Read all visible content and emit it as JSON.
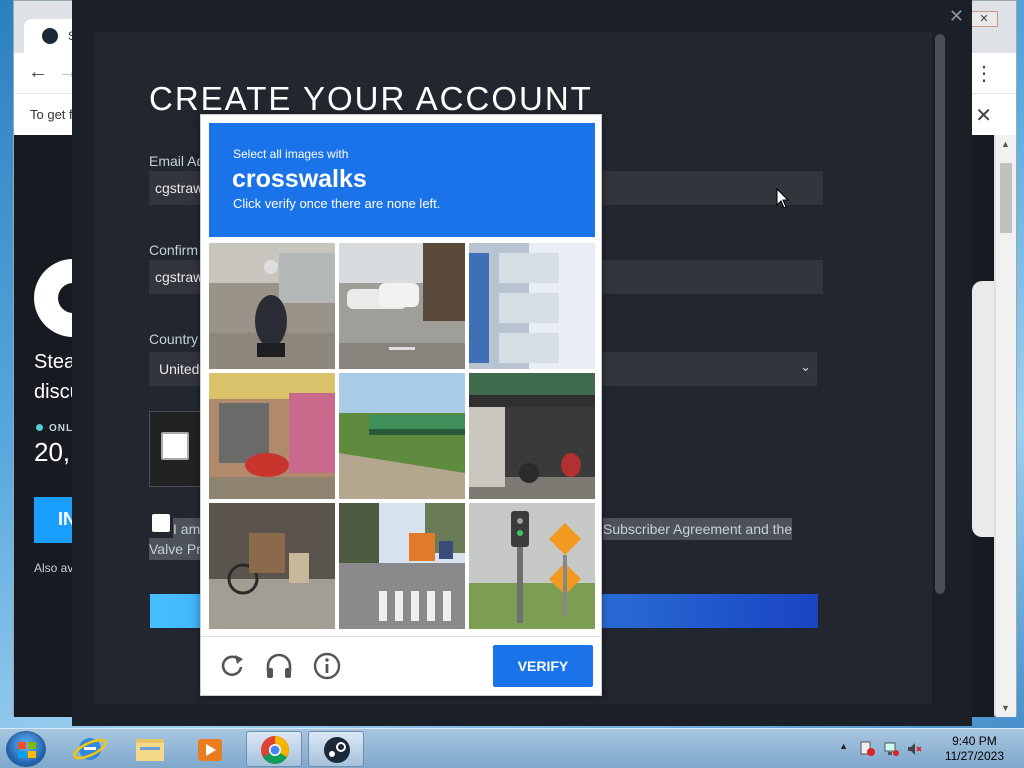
{
  "browser": {
    "tab_title": "Ste",
    "infobar_text": "To get f",
    "close_glyph": "✕",
    "back_glyph": "←",
    "forward_glyph": "→",
    "menu_glyph": "⋮"
  },
  "steam_page": {
    "headline_line1": "Stea",
    "headline_line2": "discu",
    "online_label": "ONLI",
    "online_count": "20,",
    "install_label": "IN",
    "also_available": "Also av"
  },
  "modal": {
    "close_glyph": "✕",
    "title": "CREATE YOUR ACCOUNT",
    "email_label": "Email Ad",
    "email_value": "cgstraw",
    "confirm_label": "Confirm",
    "confirm_value": "cgstraw",
    "country_label": "Country",
    "country_value": "United",
    "chevron_glyph": "⌄",
    "agree_prefix": "I am",
    "agree_suffix": "Subscriber Agreement and the",
    "agree_line2": "Valve Pr"
  },
  "captcha": {
    "instruction_pre": "Select all images with",
    "keyword": "crosswalks",
    "instruction_post": "Click verify once there are none left.",
    "verify_label": "VERIFY",
    "tiles": [
      {
        "subject": "scooter-rider-street"
      },
      {
        "subject": "parked-cars-street"
      },
      {
        "subject": "building-balconies"
      },
      {
        "subject": "shop-storefront-motorbike"
      },
      {
        "subject": "bridge-over-embankment"
      },
      {
        "subject": "motorbikes-under-canopy"
      },
      {
        "subject": "bicycle-indoor"
      },
      {
        "subject": "street-crosswalk-bus"
      },
      {
        "subject": "traffic-light-signs"
      }
    ],
    "controls": {
      "reload": "reload-icon",
      "audio": "headphones-icon",
      "info": "info-icon"
    }
  },
  "taskbar": {
    "time": "9:40 PM",
    "date": "11/27/2023",
    "tray_arrow": "▲",
    "apps": [
      "internet-explorer",
      "file-explorer",
      "media-player",
      "chrome",
      "steam"
    ]
  }
}
